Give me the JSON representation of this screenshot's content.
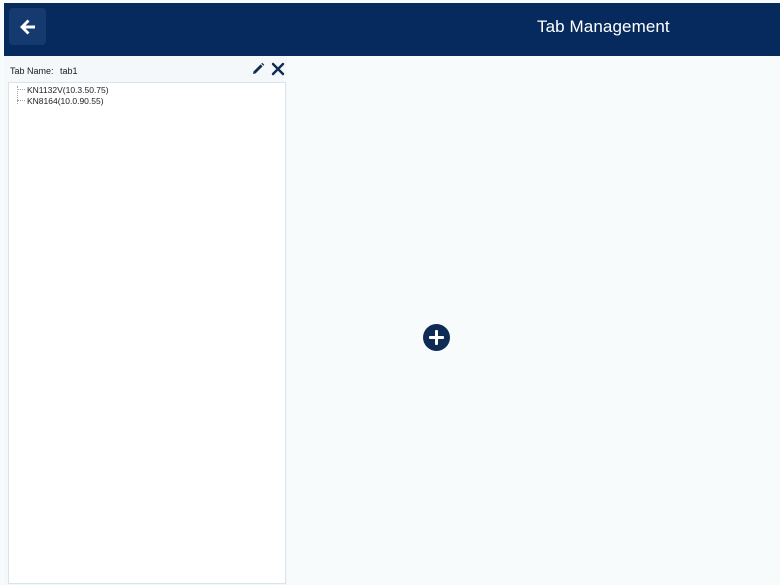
{
  "header": {
    "title": "Tab Management",
    "back_icon": "arrow-left-icon"
  },
  "tab_panel": {
    "name_label": "Tab Name:",
    "name_value": "tab1",
    "edit_icon": "pencil-icon",
    "close_icon": "close-icon",
    "devices": [
      {
        "label": "KN1132V(10.3.50.75)"
      },
      {
        "label": "KN8164(10.0.90.55)"
      }
    ]
  },
  "main": {
    "add_icon": "plus-circle-icon"
  },
  "colors": {
    "header_bg": "#062a5e",
    "page_bg": "#f8fbfc",
    "accent": "#0d2b55"
  }
}
